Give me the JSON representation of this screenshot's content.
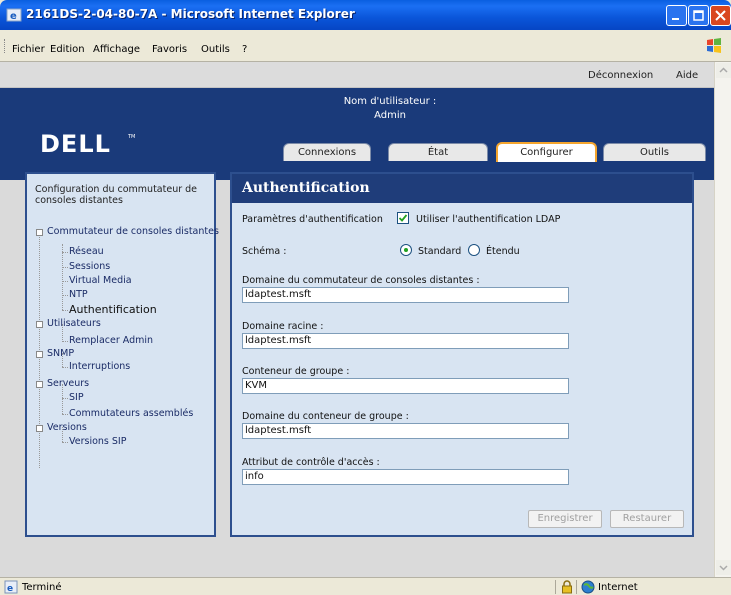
{
  "window": {
    "title": "2161DS-2-04-80-7A - Microsoft Internet Explorer"
  },
  "menu": {
    "items": [
      "Fichier",
      "Edition",
      "Affichage",
      "Favoris",
      "Outils",
      "?"
    ]
  },
  "topbar": {
    "logout": "Déconnexion",
    "help": "Aide"
  },
  "banner": {
    "user_label": "Nom d'utilisateur :",
    "user_value": "Admin",
    "logo_text": "DELL"
  },
  "tabs": [
    {
      "label": "Connexions",
      "active": false
    },
    {
      "label": "État",
      "active": false
    },
    {
      "label": "Configurer",
      "active": true
    },
    {
      "label": "Outils",
      "active": false
    }
  ],
  "sidebar": {
    "heading": "Configuration du commutateur de consoles distantes",
    "items": [
      {
        "label": "Commutateur de consoles distantes"
      },
      {
        "label": "Réseau"
      },
      {
        "label": "Sessions"
      },
      {
        "label": "Virtual Media"
      },
      {
        "label": "NTP"
      },
      {
        "label": "Authentification"
      },
      {
        "label": "Utilisateurs"
      },
      {
        "label": "Remplacer Admin"
      },
      {
        "label": "SNMP"
      },
      {
        "label": "Interruptions"
      },
      {
        "label": "Serveurs"
      },
      {
        "label": "SIP"
      },
      {
        "label": "Commutateurs assemblés"
      },
      {
        "label": "Versions"
      },
      {
        "label": "Versions SIP"
      }
    ]
  },
  "main": {
    "title": "Authentification",
    "auth_params_label": "Paramètres d'authentification",
    "ldap_checkbox_label": "Utiliser l'authentification LDAP",
    "ldap_checked": true,
    "schema_label": "Schéma :",
    "schema_options": [
      "Standard",
      "Étendu"
    ],
    "schema_selected": "Standard",
    "fields": [
      {
        "label": "Domaine du commutateur de consoles distantes :",
        "value": "ldaptest.msft"
      },
      {
        "label": "Domaine racine :",
        "value": "ldaptest.msft"
      },
      {
        "label": "Conteneur de groupe :",
        "value": "KVM"
      },
      {
        "label": "Domaine du conteneur de groupe :",
        "value": "ldaptest.msft"
      },
      {
        "label": "Attribut de contrôle d'accès :",
        "value": "info"
      }
    ],
    "save_label": "Enregistrer",
    "restore_label": "Restaurer"
  },
  "status": {
    "text": "Terminé",
    "zone": "Internet"
  }
}
